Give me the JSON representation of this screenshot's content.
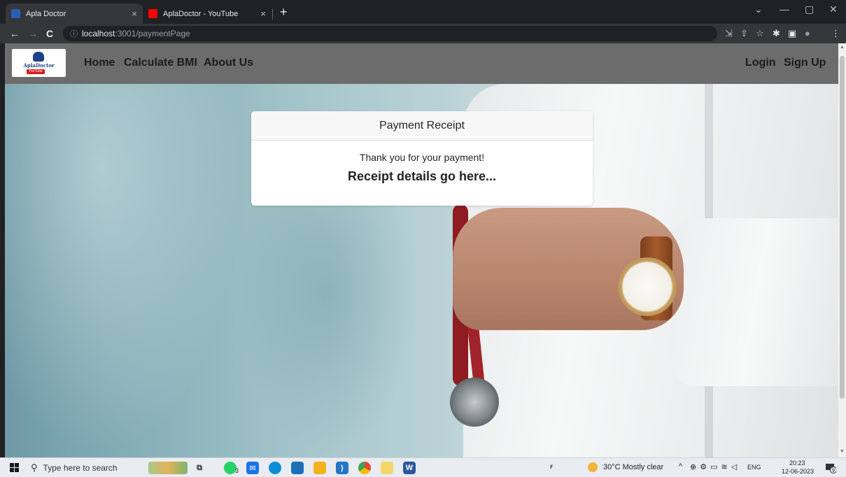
{
  "browser": {
    "tabs": [
      {
        "title": "Apla Doctor",
        "active": true,
        "favicon_color": "#2b5fb3"
      },
      {
        "title": "AplaDoctor - YouTube",
        "active": false,
        "favicon_color": "#ff0000"
      }
    ],
    "new_tab_glyph": "+",
    "close_glyph": "×",
    "window_controls": {
      "collapse": "⌄",
      "minimize": "—",
      "maximize": "▢",
      "close": "✕"
    },
    "nav": {
      "back": "←",
      "forward": "→",
      "reload": "C"
    },
    "address": {
      "info_icon": "ⓘ",
      "host": "localhost",
      "path": ":3001/paymentPage"
    },
    "toolbar_icons": [
      "⇲",
      "⇪",
      "☆",
      "✱",
      "▣",
      "●",
      "⋮"
    ]
  },
  "site": {
    "logo": {
      "brand": "AplaDoctor",
      "badge": "YouTube"
    },
    "nav_left": [
      "Home",
      "Calculate BMI",
      "About Us"
    ],
    "nav_right": [
      "Login",
      "Sign Up"
    ]
  },
  "receipt": {
    "header": "Payment Receipt",
    "message": "Thank you for your payment!",
    "details": "Receipt details go here..."
  },
  "taskbar": {
    "search_placeholder": "Type here to search",
    "whatsapp_badge": "3",
    "weather": "30°C  Mostly clear",
    "tray_language": "ENG",
    "time": "20:23",
    "date": "12-06-2023",
    "notification_count": "9"
  },
  "colors": {
    "navbar_bg": "#6c6c6c",
    "card_header_bg": "#f7f7f7",
    "browser_dark": "#202124",
    "browser_toolbar": "#35363a"
  }
}
